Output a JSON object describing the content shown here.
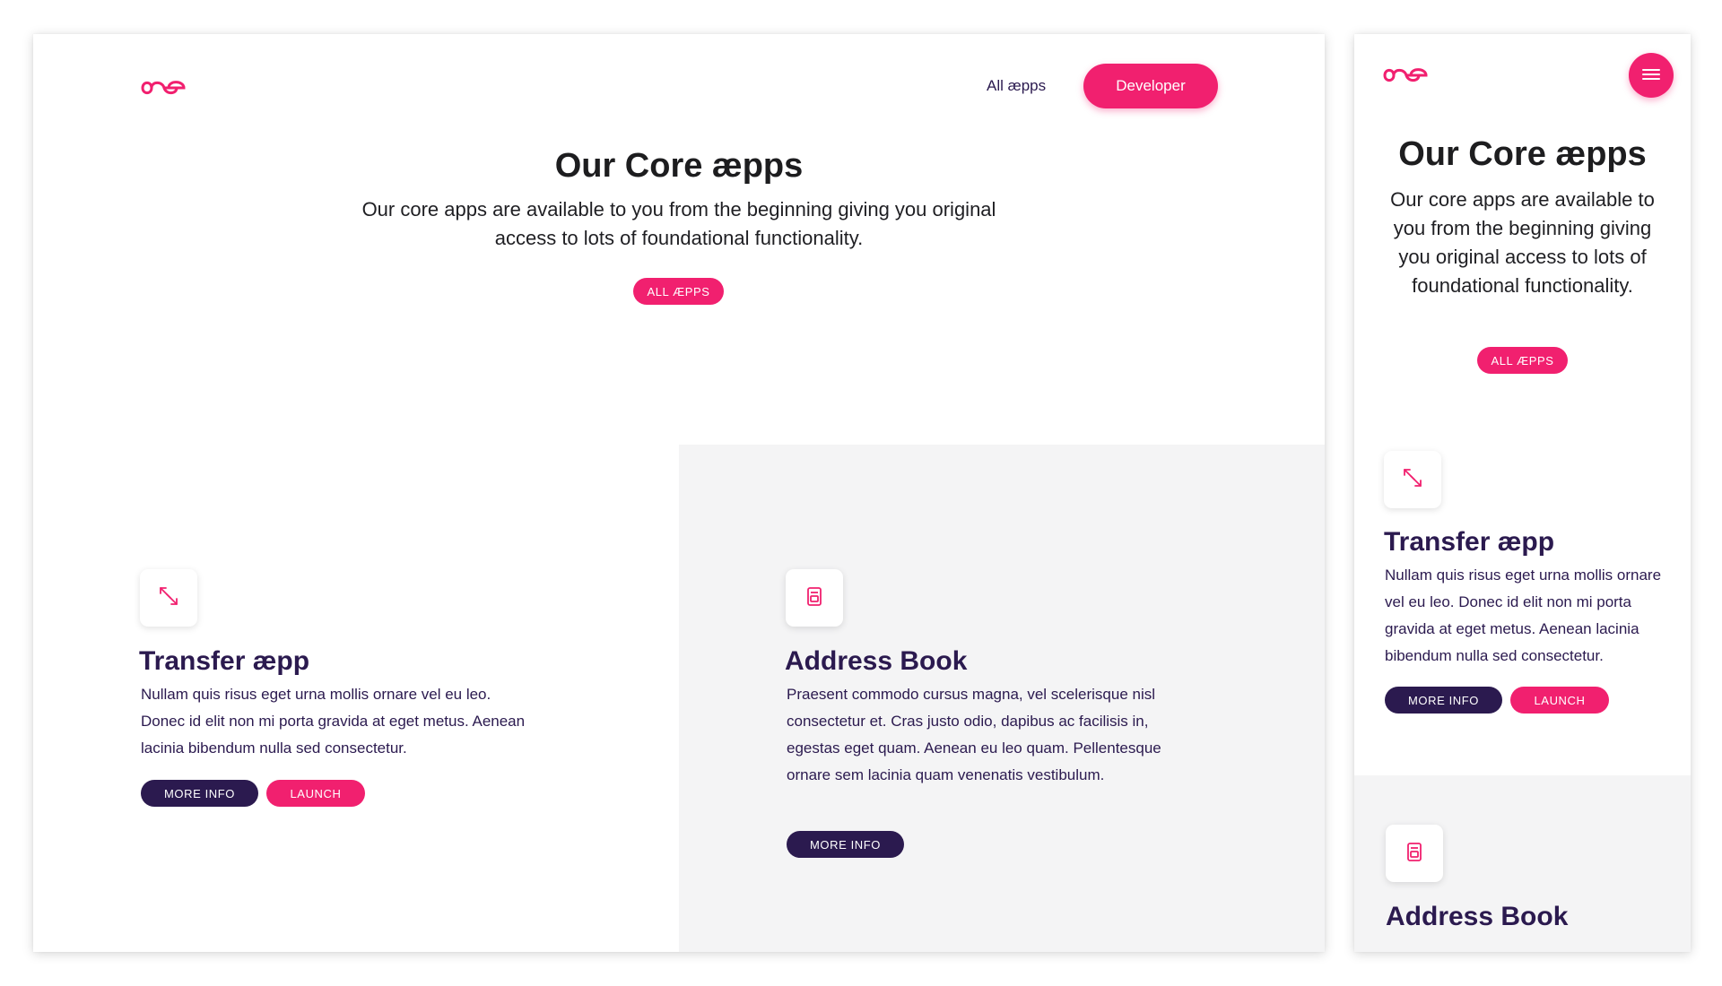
{
  "brand": {
    "accent": "#f1206f",
    "dark": "#2b1a4f",
    "logo_icon": "infinity-ae-logo"
  },
  "nav": {
    "all_apps_label": "All æpps",
    "developer_label": "Developer"
  },
  "mobile_nav": {
    "menu_icon": "hamburger-menu-icon"
  },
  "hero": {
    "title": "Our Core æpps",
    "description": "Our core apps are available to you from the beginning giving you original access to lots of foundational functionality.",
    "cta_label": "ALL ÆPPS"
  },
  "apps": [
    {
      "icon": "transfer-arrows-icon",
      "title": "Transfer æpp",
      "description": "Nullam quis risus eget urna mollis ornare vel eu leo. Donec id elit non mi porta gravida at eget metus. Aenean lacinia bibendum nulla sed consectetur.",
      "more_info_label": "MORE INFO",
      "launch_label": "LAUNCH"
    },
    {
      "icon": "address-book-icon",
      "title": "Address Book",
      "description": "Praesent commodo cursus magna, vel scelerisque nisl consectetur et. Cras justo odio, dapibus ac facilisis in, egestas eget quam. Aenean eu leo quam. Pellentesque ornare sem lacinia quam venenatis vestibulum.",
      "more_info_label": "MORE INFO"
    }
  ]
}
